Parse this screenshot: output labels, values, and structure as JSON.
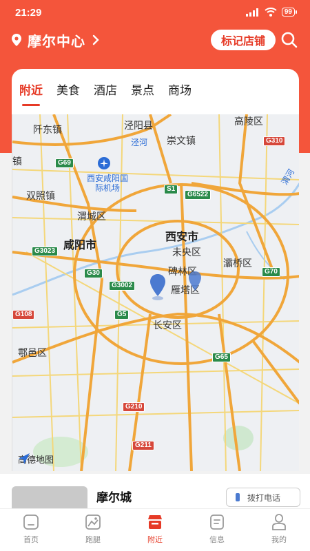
{
  "status_bar": {
    "time": "21:29",
    "battery": "99"
  },
  "header": {
    "location": "摩尔中心",
    "mark_button": "标记店铺"
  },
  "tabs": [
    {
      "label": "附近",
      "active": true
    },
    {
      "label": "美食",
      "active": false
    },
    {
      "label": "酒店",
      "active": false
    },
    {
      "label": "景点",
      "active": false
    },
    {
      "label": "商场",
      "active": false
    }
  ],
  "map": {
    "labels": {
      "qianyang": "阡东镇",
      "jingyang": "泾阳县",
      "jinghe": "泾河",
      "chongwen": "崇文镇",
      "gaoling": "高陵区",
      "airport": "西安咸阳国际机场",
      "shuangzhao": "双照镇",
      "weicheng": "渭城区",
      "xian": "西安市",
      "xianyang": "咸阳市",
      "weiyang": "未央区",
      "beilin": "碑林区",
      "yanta": "雁塔区",
      "baqiao": "灞桥区",
      "changan": "长安区",
      "huyi": "鄠邑区",
      "zhen": "镇",
      "weihe": "渭河"
    },
    "shields": [
      "G69",
      "G310",
      "S1",
      "G6522",
      "G3023",
      "G30",
      "G3002",
      "G70",
      "G5",
      "G65",
      "G210",
      "G211",
      "G108"
    ],
    "logo": "高德地图"
  },
  "list": {
    "store_name": "摩尔城",
    "call_button": "拨打电话"
  },
  "tabbar": [
    {
      "label": "首页",
      "icon": "home-icon",
      "active": false
    },
    {
      "label": "跑腿",
      "icon": "errand-icon",
      "active": false
    },
    {
      "label": "附近",
      "icon": "nearby-store-icon",
      "active": true
    },
    {
      "label": "信息",
      "icon": "info-icon",
      "active": false
    },
    {
      "label": "我的",
      "icon": "profile-icon",
      "active": false
    }
  ],
  "colors": {
    "brand": "#f4553b",
    "accent": "#e63a26",
    "highway": "#f0a63a",
    "highway_shield": "#2a8a4a"
  }
}
